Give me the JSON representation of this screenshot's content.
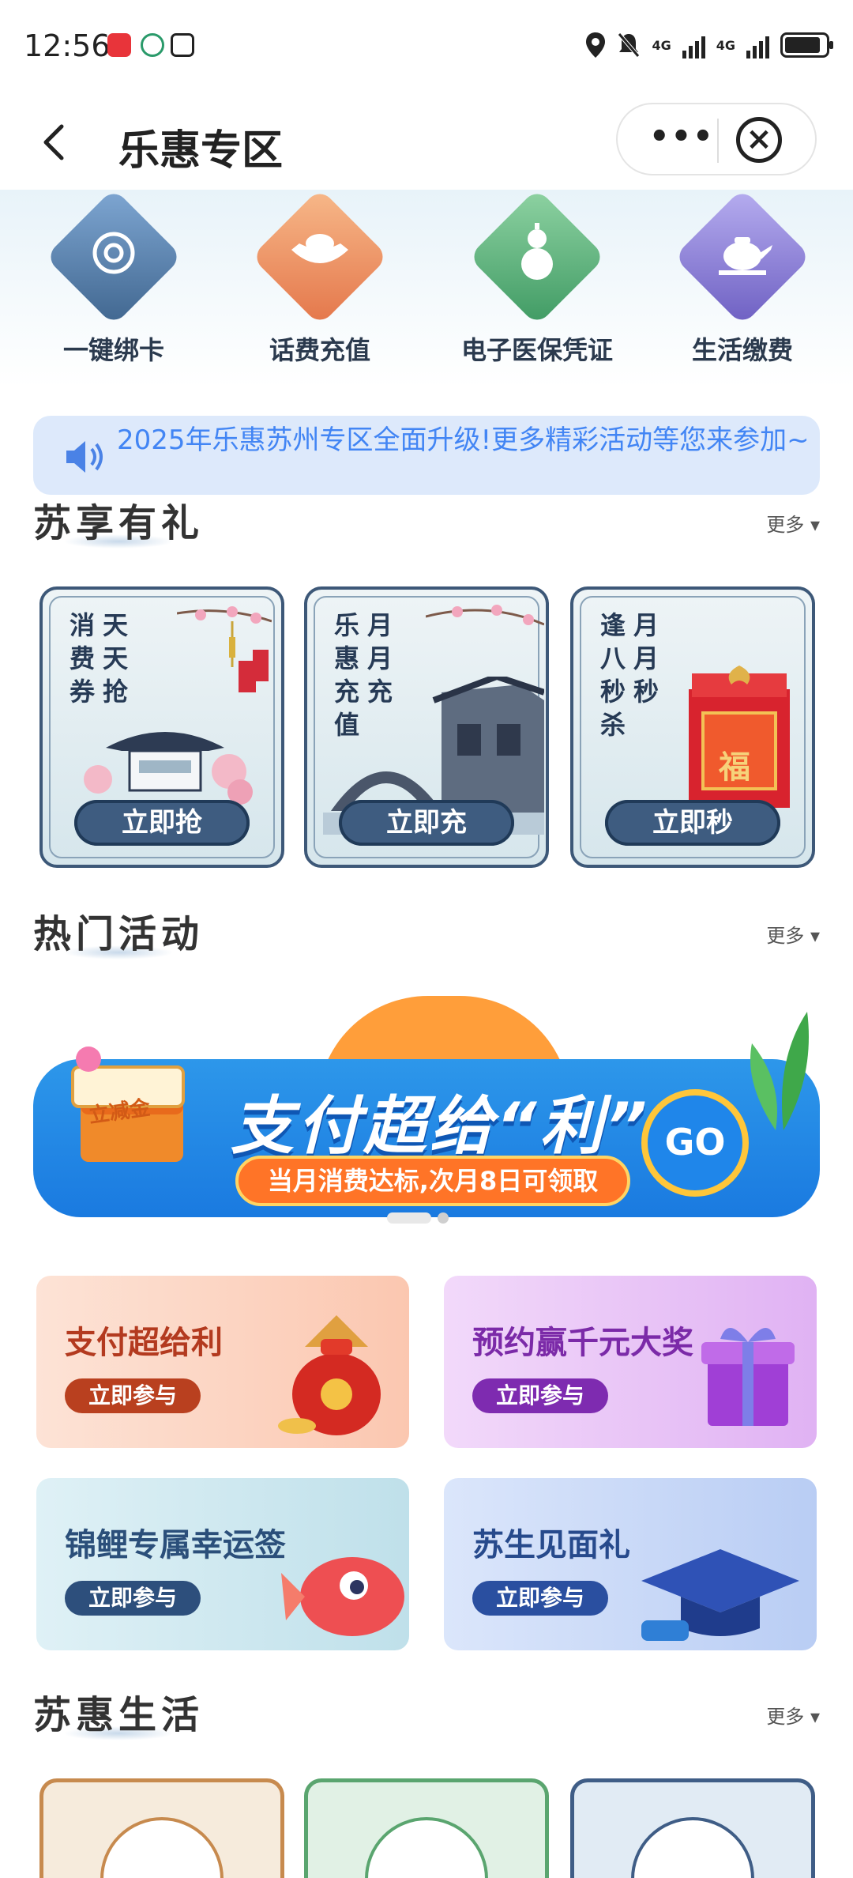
{
  "status_bar": {
    "time": "12:56",
    "net1": "4G",
    "net2": "4G"
  },
  "header": {
    "title": "乐惠专区",
    "back_glyph": "‹",
    "more_glyph": "•••",
    "close_glyph": "×"
  },
  "services": [
    {
      "label": "一键绑卡",
      "icon": "card-bind-icon",
      "color": "#4f7cb0"
    },
    {
      "label": "话费充值",
      "icon": "gold-ingot-icon",
      "color": "#e98a4c"
    },
    {
      "label": "电子医保凭证",
      "icon": "gourd-icon",
      "color": "#4fa870"
    },
    {
      "label": "生活缴费",
      "icon": "teapot-icon",
      "color": "#7a6fc8"
    }
  ],
  "notice": {
    "text": "2025年乐惠苏州专区全面升级!更多精彩活动等您来参加~"
  },
  "sections": {
    "suxiang": {
      "title": "苏享有礼",
      "more": "更多 ▾"
    },
    "hot": {
      "title": "热门活动",
      "more": "更多 ▾"
    },
    "suhui": {
      "title": "苏惠生活",
      "more": "更多 ▾"
    }
  },
  "suxiang_cards": [
    {
      "col1": "消费券",
      "col2": "天天抢",
      "cta": "立即抢"
    },
    {
      "col1": "乐惠充值",
      "col2": "月月充",
      "cta": "立即充"
    },
    {
      "col1": "逢八秒杀",
      "col2": "月月秒",
      "cta": "立即秒",
      "fu": "福"
    }
  ],
  "hot_banner": {
    "tag": "立减金",
    "main": "支付超给“利”",
    "sub": "当月消费达标,次月8日可领取",
    "go": "GO"
  },
  "activities": [
    {
      "title": "支付超给利",
      "cta": "立即参与",
      "title_color": "#b33a1f",
      "btn_color": "#b9401f"
    },
    {
      "title": "预约赢千元大奖",
      "cta": "立即参与",
      "title_color": "#7b2aa8",
      "btn_color": "#7e2bb0"
    },
    {
      "title": "锦鲤专属幸运签",
      "cta": "立即参与",
      "title_color": "#2b4f7a",
      "btn_color": "#2d4f7c"
    },
    {
      "title": "苏生见面礼",
      "cta": "立即参与",
      "title_color": "#274a8c",
      "btn_color": "#2a4fa0"
    }
  ]
}
